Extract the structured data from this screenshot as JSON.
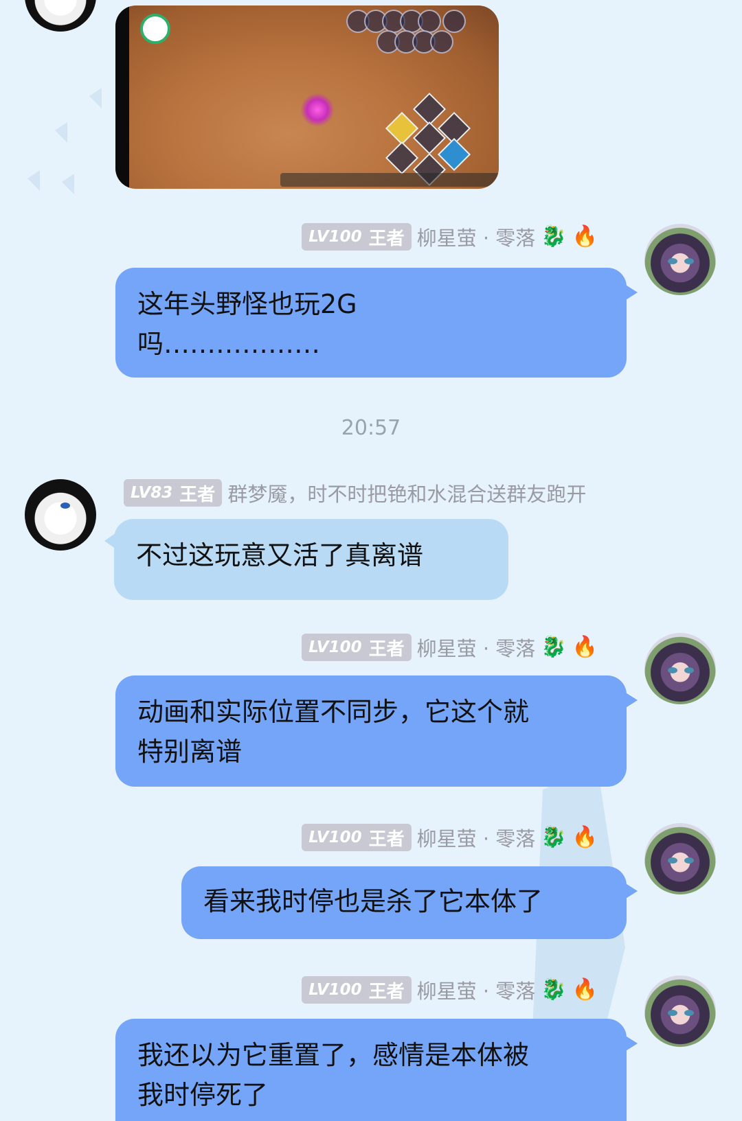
{
  "self_user": {
    "level": "LV100",
    "title": "王者",
    "name": "柳星萤 · 零落",
    "emojis": [
      "🐉",
      "🔥"
    ]
  },
  "other_user": {
    "level": "LV83",
    "title": "王者",
    "name": "群梦魇，时不时把铯和水混合送群友跑开"
  },
  "timestamp": "20:57",
  "messages": [
    {
      "sender": "self",
      "lines": [
        "这年头野怪也玩2G",
        "吗………………"
      ]
    },
    {
      "sender": "other",
      "lines": [
        "不过这玩意又活了真离谱"
      ]
    },
    {
      "sender": "self",
      "lines": [
        "动画和实际位置不同步，它这个就",
        "特别离谱"
      ]
    },
    {
      "sender": "self",
      "lines": [
        "看来我时停也是杀了它本体了"
      ]
    },
    {
      "sender": "self",
      "lines": [
        "我还以为它重置了，感情是本体被",
        "我时停死了"
      ]
    }
  ],
  "colors": {
    "background": "#e6f2fc",
    "self_bubble": "#75a5f8",
    "other_bubble": "#b9daf5",
    "badge": "#c9c9d3"
  }
}
